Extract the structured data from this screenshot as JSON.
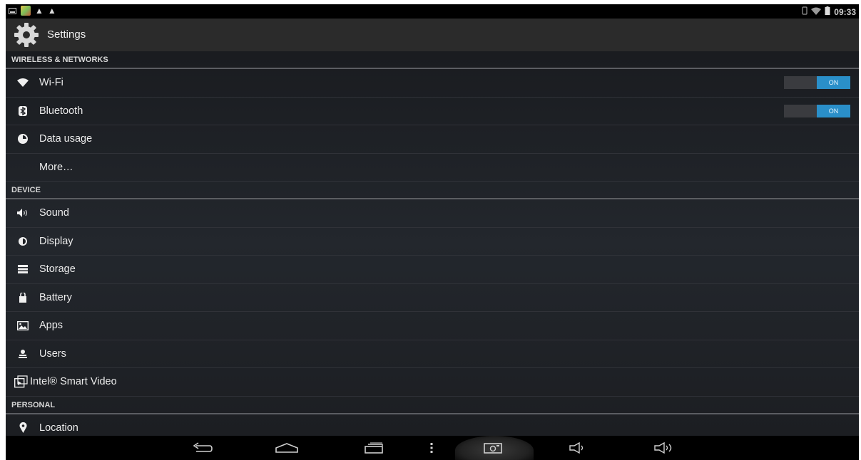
{
  "status_bar": {
    "time": "09:33",
    "left_icons": [
      "notification-icon",
      "app-notification-icon",
      "warning-icon",
      "warning-icon"
    ],
    "right_icons": [
      "vibrate-icon",
      "wifi-icon",
      "battery-icon"
    ]
  },
  "action_bar": {
    "title": "Settings",
    "icon": "gear-icon"
  },
  "sections": [
    {
      "header": "WIRELESS & NETWORKS",
      "items": [
        {
          "label": "Wi-Fi",
          "icon": "wifi-icon",
          "toggle": "ON"
        },
        {
          "label": "Bluetooth",
          "icon": "bluetooth-icon",
          "toggle": "ON"
        },
        {
          "label": "Data usage",
          "icon": "data-usage-icon"
        },
        {
          "label": "More…",
          "icon": ""
        }
      ]
    },
    {
      "header": "DEVICE",
      "items": [
        {
          "label": "Sound",
          "icon": "speaker-icon"
        },
        {
          "label": "Display",
          "icon": "display-icon"
        },
        {
          "label": "Storage",
          "icon": "storage-icon"
        },
        {
          "label": "Battery",
          "icon": "battery-icon"
        },
        {
          "label": "Apps",
          "icon": "apps-icon"
        },
        {
          "label": "Users",
          "icon": "users-icon"
        },
        {
          "label": "Intel® Smart Video",
          "icon": "smart-video-icon"
        }
      ]
    },
    {
      "header": "PERSONAL",
      "items": [
        {
          "label": "Location",
          "icon": "location-icon"
        }
      ]
    }
  ],
  "nav_bar": {
    "buttons": [
      "back-icon",
      "home-icon",
      "recents-icon",
      "menu-icon",
      "screenshot-icon",
      "volume-down-icon",
      "volume-up-icon"
    ]
  },
  "colors": {
    "toggle_on": "#2a8fc9",
    "action_bar": "#2b2b2b",
    "status_bar": "#000000"
  }
}
